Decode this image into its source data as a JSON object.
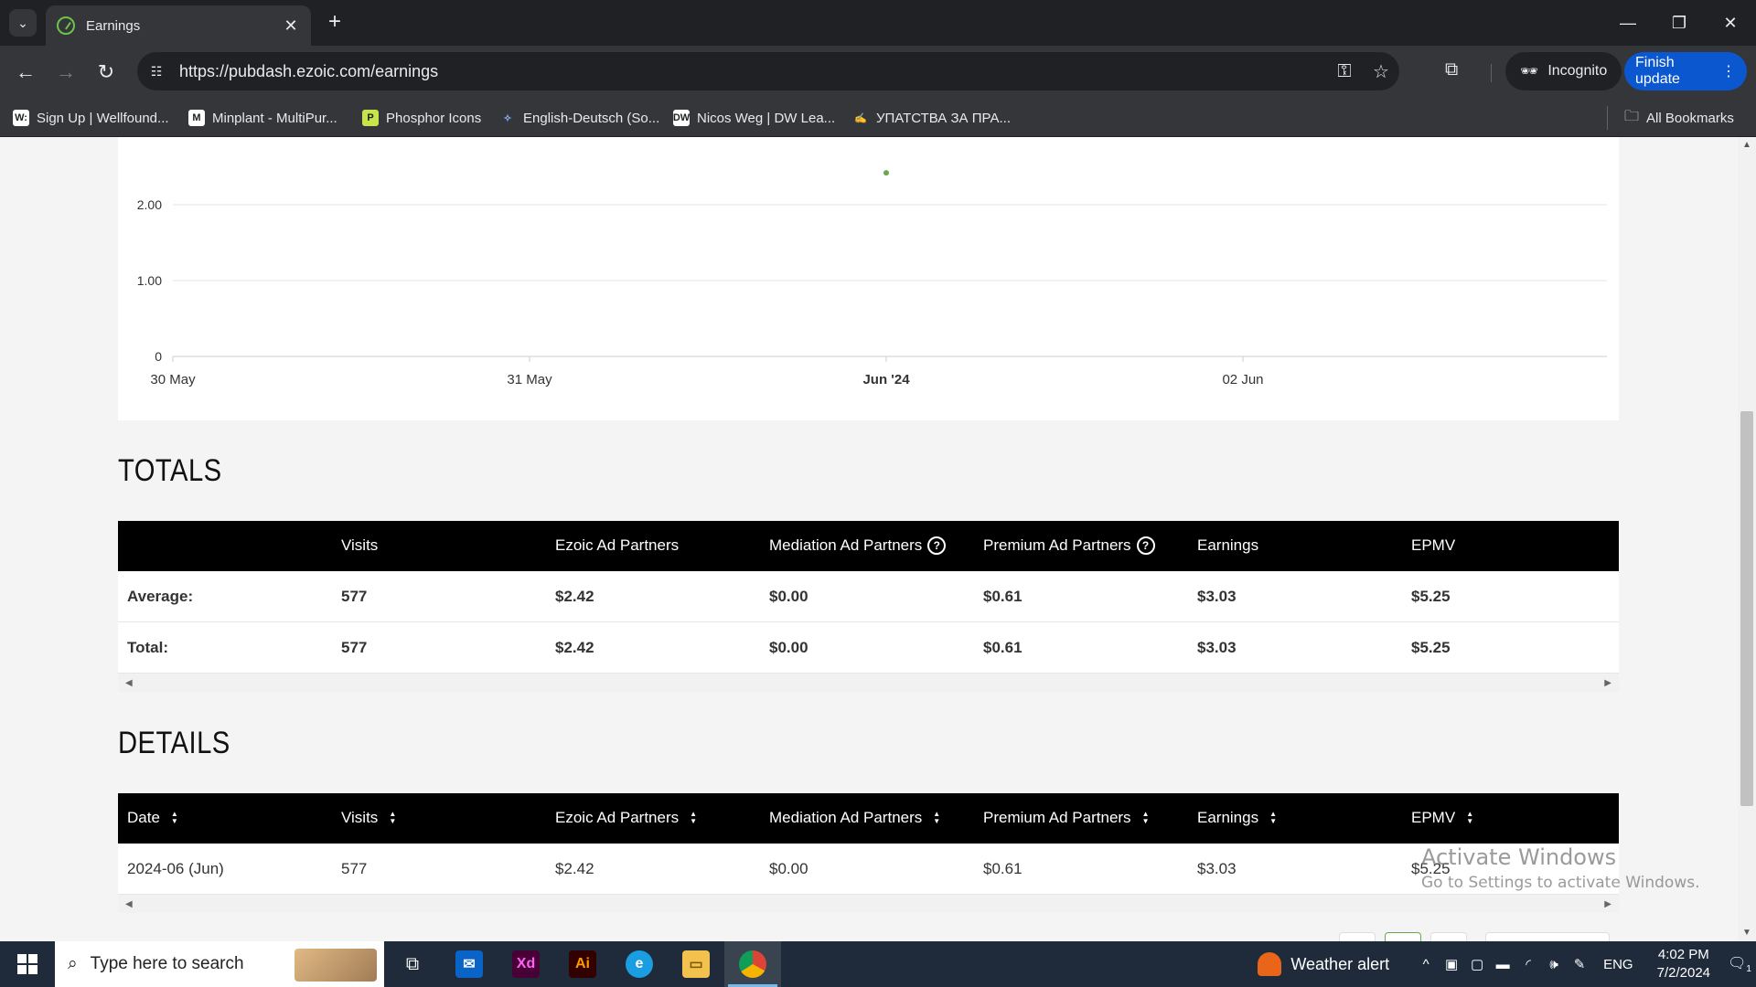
{
  "browser": {
    "tab_title": "Earnings",
    "url": "https://pubdash.ezoic.com/earnings",
    "incognito_label": "Incognito",
    "finish_update_label": "Finish update",
    "bookmarks": [
      {
        "label": "Sign Up | Wellfound...",
        "icon": "W:",
        "color": "#ffffff"
      },
      {
        "label": "Minplant - MultiPur...",
        "icon": "M",
        "color": "#ffffff"
      },
      {
        "label": "Phosphor Icons",
        "icon": "P",
        "color": "#c6e44b"
      },
      {
        "label": "English-Deutsch (So...",
        "icon": "✧",
        "color": "#35363a"
      },
      {
        "label": "Nicos Weg | DW Lea...",
        "icon": "DW",
        "color": "#ffffff"
      },
      {
        "label": "УПАТСТВА ЗА ПРА...",
        "icon": "✍",
        "color": "#35363a"
      }
    ],
    "all_bookmarks_label": "All Bookmarks"
  },
  "chart_data": {
    "type": "line",
    "x_ticks": [
      "30 May",
      "31 May",
      "Jun '24",
      "02 Jun"
    ],
    "y_ticks": [
      "0",
      "1.00",
      "2.00"
    ],
    "ylim": [
      0,
      3.5
    ],
    "series": [
      {
        "x": [
          "Jun '24"
        ],
        "values": [
          2.42
        ],
        "color": "#6aa84f"
      }
    ]
  },
  "totals": {
    "title": "TOTALS",
    "headers": [
      "",
      "Visits",
      "Ezoic Ad Partners",
      "Mediation Ad Partners",
      "Premium Ad Partners",
      "Earnings",
      "EPMV"
    ],
    "help_on": [
      3,
      4
    ],
    "rows": [
      [
        "Average:",
        "577",
        "$2.42",
        "$0.00",
        "$0.61",
        "$3.03",
        "$5.25"
      ],
      [
        "Total:",
        "577",
        "$2.42",
        "$0.00",
        "$0.61",
        "$3.03",
        "$5.25"
      ]
    ]
  },
  "details": {
    "title": "DETAILS",
    "headers": [
      "Date",
      "Visits",
      "Ezoic Ad Partners",
      "Mediation Ad Partners",
      "Premium Ad Partners",
      "Earnings",
      "EPMV"
    ],
    "rows": [
      [
        "2024-06 (Jun)",
        "577",
        "$2.42",
        "$0.00",
        "$0.61",
        "$3.03",
        "$5.25"
      ]
    ]
  },
  "watermark": {
    "line1": "Activate Windows",
    "line2": "Go to Settings to activate Windows."
  },
  "taskbar": {
    "search_placeholder": "Type here to search",
    "weather": "Weather alert",
    "lang": "ENG",
    "time": "4:02 PM",
    "date": "7/2/2024",
    "notif_count": "1"
  }
}
